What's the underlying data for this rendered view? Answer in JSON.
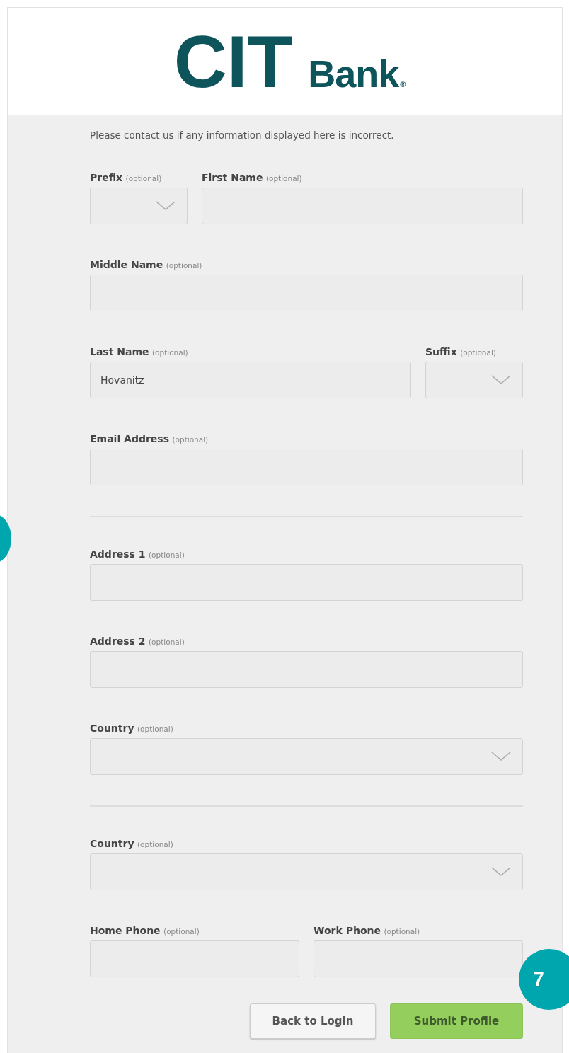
{
  "logo": {
    "mark": "CIT",
    "word": "Bank",
    "registered": "®"
  },
  "notice": "Please contact us if any information displayed here is incorrect.",
  "sections": [
    {
      "rows": [
        {
          "fields": [
            {
              "label": "Prefix",
              "hint": "(optional)",
              "kind": "select"
            },
            {
              "label": "First Name",
              "hint": "(optional)",
              "kind": "text"
            }
          ]
        },
        {
          "fields": [
            {
              "label": "Middle Name",
              "hint": "(optional)",
              "kind": "text"
            }
          ]
        },
        {
          "fields": [
            {
              "label": "Last Name",
              "hint": "(optional)",
              "kind": "text",
              "value": "Hovanitz"
            },
            {
              "label": "Suffix",
              "hint": "(optional)",
              "kind": "select"
            }
          ]
        },
        {
          "fields": [
            {
              "label": "Email Address",
              "hint": "(optional)",
              "kind": "text"
            }
          ]
        }
      ]
    },
    {
      "rows": [
        {
          "fields": [
            {
              "label": "Address 1",
              "hint": "(optional)",
              "kind": "text"
            }
          ]
        },
        {
          "fields": [
            {
              "label": "Address 2",
              "hint": "(optional)",
              "kind": "text"
            }
          ]
        },
        {
          "fields": [
            {
              "label": "Country",
              "hint": "(optional)",
              "kind": "select"
            }
          ]
        }
      ]
    },
    {
      "rows": [
        {
          "fields": [
            {
              "label": "Country",
              "hint": "(optional)",
              "kind": "select"
            }
          ]
        },
        {
          "fields": [
            {
              "label": "Home Phone",
              "hint": "(optional)",
              "kind": "text"
            },
            {
              "label": "Work Phone",
              "hint": "(optional)",
              "kind": "text"
            }
          ]
        }
      ]
    }
  ],
  "buttons": [
    {
      "label": "Back to Login",
      "kind": "secondary"
    },
    {
      "label": "Submit Profile",
      "kind": "primary"
    }
  ],
  "callout": {
    "label": "7"
  }
}
